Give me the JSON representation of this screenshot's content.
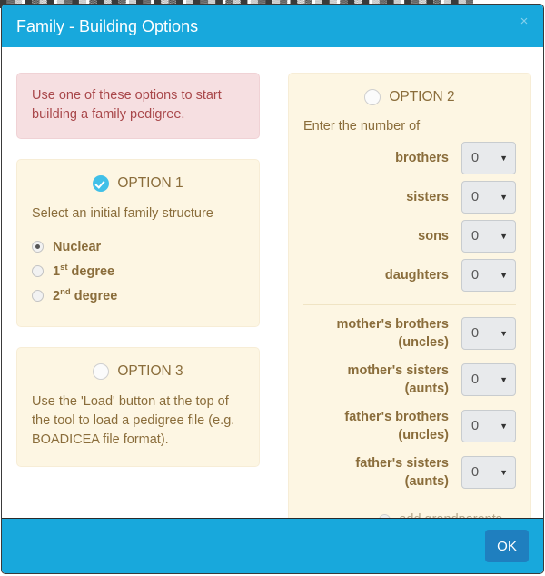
{
  "background": {
    "obscured_text": "█▓▒ █▓▒█ ▒▓█▒ ▓█▒█▓ ▒█▓ █▒▓█ ▒█▓▒█ ▓▒█ ▒▓█▒▓ █▒▓ ▒█▒ ▓█▒█ ▒▓█▒ █▓▒█▓ ▒█▒▓"
  },
  "colors": {
    "header": "#18a8dc",
    "footer": "#18a8dc",
    "ok_button": "#1f7fbf",
    "alert_bg": "#f6dfe1",
    "alert_text": "#a9484b",
    "panel_bg": "#fdf6e3",
    "panel_text": "#8a6d3b",
    "check_badge": "#41c0e8",
    "select_bg": "#e8eaec",
    "disabled_text": "#b3a58a"
  },
  "header": {
    "title": "Family - Building Options",
    "close_icon": "close-icon",
    "close_glyph": "×"
  },
  "alert": {
    "text": "Use one of these options to start building a family pedigree."
  },
  "option1": {
    "badge": "check-badge-icon",
    "label": "OPTION 1",
    "description": "Select an initial family structure",
    "radios": [
      {
        "label": "Nuclear",
        "label_sup": "",
        "label_rest": "",
        "selected": true
      },
      {
        "label": "",
        "label_main": "1",
        "label_sup": "st",
        "label_rest": " degree",
        "selected": false
      },
      {
        "label": "",
        "label_main": "2",
        "label_sup": "nd",
        "label_rest": " degree",
        "selected": false
      }
    ]
  },
  "option3": {
    "badge": "empty-circle-icon",
    "label": "OPTION 3",
    "description": "Use the 'Load' button at the top of the tool to load a pedigree file (e.g. BOADICEA file format)."
  },
  "option2": {
    "badge": "empty-circle-icon",
    "label": "OPTION 2",
    "description": "Enter the number of",
    "caret_glyph": "▼",
    "fields": [
      {
        "label": "brothers",
        "label_line2": "",
        "value": "0"
      },
      {
        "label": "sisters",
        "label_line2": "",
        "value": "0"
      },
      {
        "label": "sons",
        "label_line2": "",
        "value": "0"
      },
      {
        "label": "daughters",
        "label_line2": "",
        "value": "0"
      }
    ],
    "fields_extended": [
      {
        "label": "mother's brothers",
        "label_line2": "(uncles)",
        "value": "0"
      },
      {
        "label": "mother's sisters",
        "label_line2": "(aunts)",
        "value": "0"
      },
      {
        "label": "father's brothers",
        "label_line2": "(uncles)",
        "value": "0"
      },
      {
        "label": "father's sisters",
        "label_line2": "(aunts)",
        "value": "0"
      }
    ],
    "grandparents": {
      "label": "add grandparents",
      "enabled": false
    }
  },
  "footer": {
    "ok_label": "OK"
  }
}
